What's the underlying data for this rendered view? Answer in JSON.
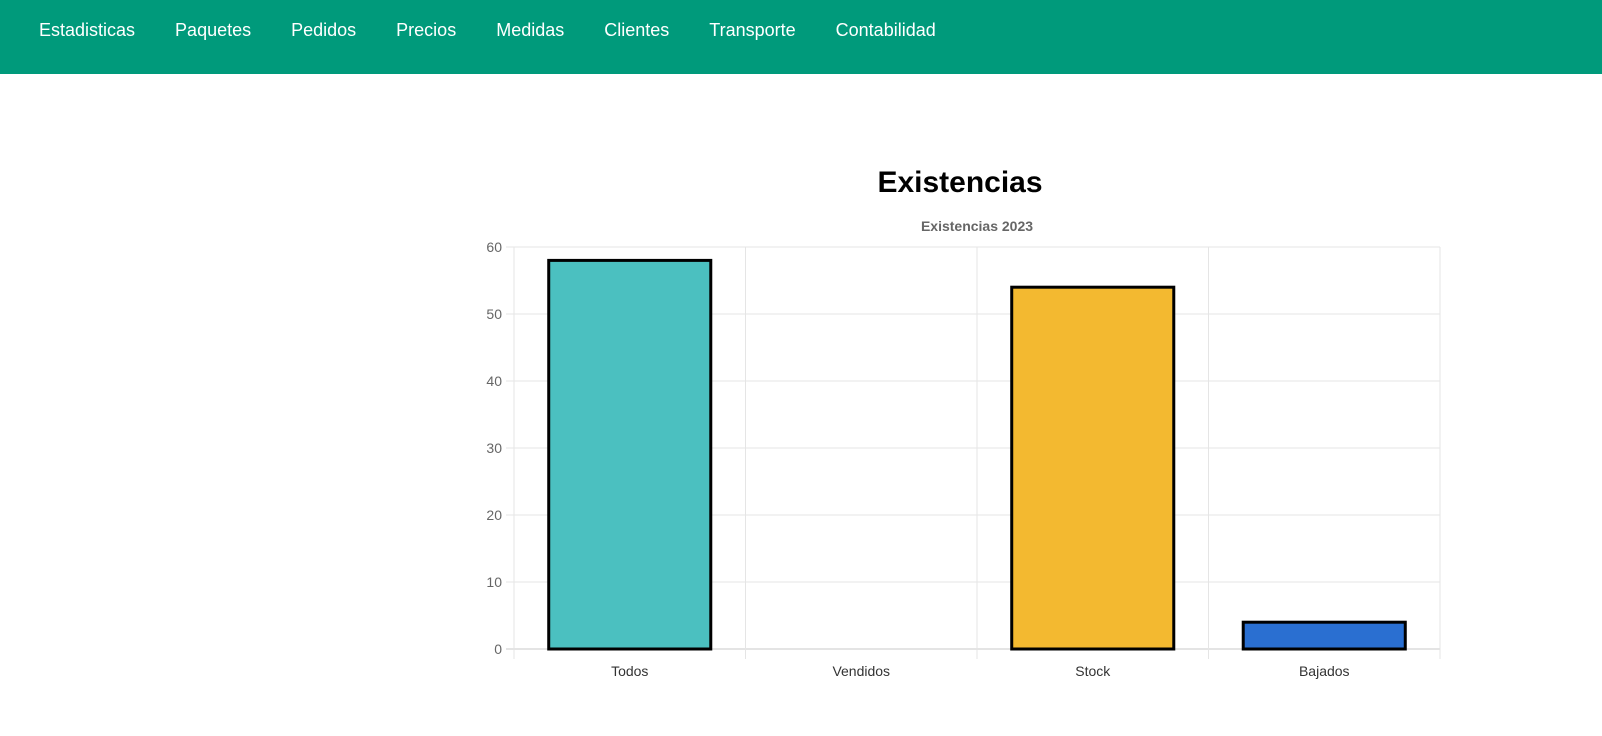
{
  "nav": {
    "items": [
      {
        "label": "Estadisticas"
      },
      {
        "label": "Paquetes"
      },
      {
        "label": "Pedidos"
      },
      {
        "label": "Precios"
      },
      {
        "label": "Medidas"
      },
      {
        "label": "Clientes"
      },
      {
        "label": "Transporte"
      },
      {
        "label": "Contabilidad"
      }
    ],
    "background": "#009a7b"
  },
  "page": {
    "heading": "Existencias"
  },
  "chart_data": {
    "type": "bar",
    "title": "Existencias 2023",
    "categories": [
      "Todos",
      "Vendidos",
      "Stock",
      "Bajados"
    ],
    "values": [
      58,
      0,
      54,
      4
    ],
    "colors": [
      "#4bc0c0",
      "#ff6384",
      "#f3b930",
      "#2a6fd1"
    ],
    "border_color": "#000000",
    "ylim": [
      0,
      60
    ],
    "yticks": [
      0,
      10,
      20,
      30,
      40,
      50,
      60
    ],
    "xlabel": "",
    "ylabel": "",
    "grid": true,
    "legend": "none"
  }
}
